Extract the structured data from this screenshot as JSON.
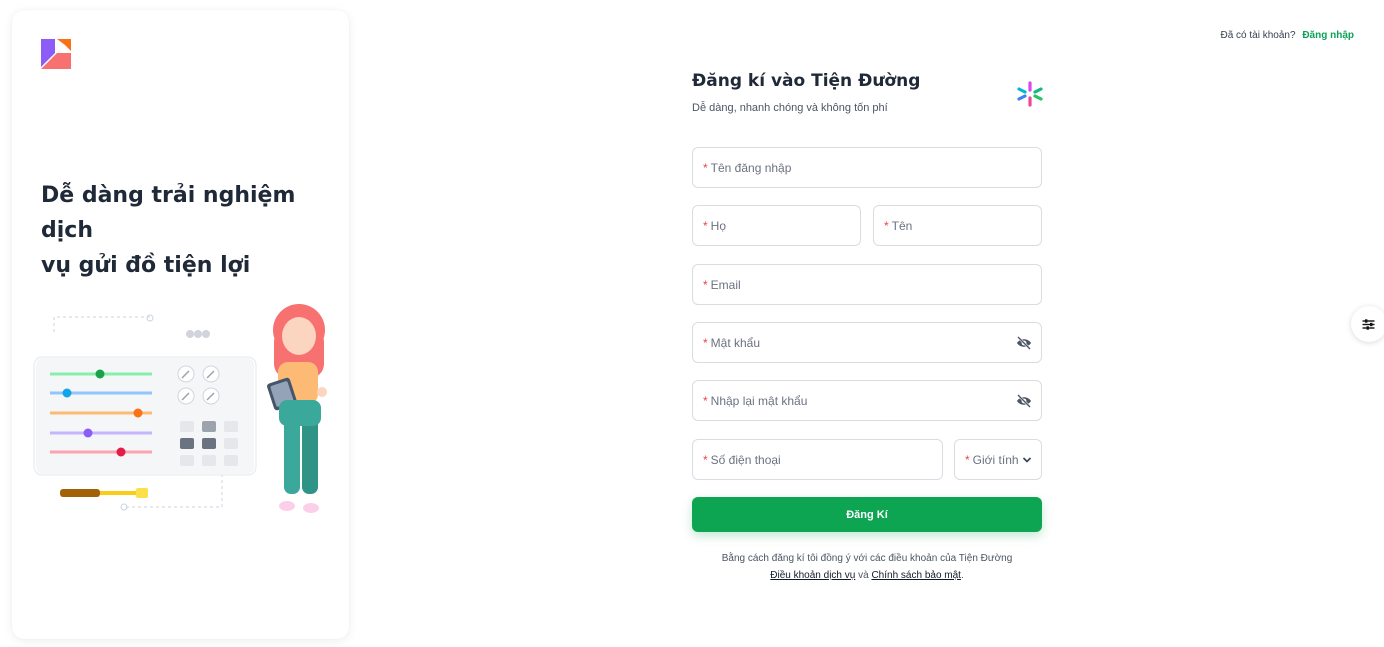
{
  "hero": {
    "line1": "Dễ dàng trải nghiệm dịch",
    "line2": "vụ gửi đồ tiện lợi"
  },
  "header": {
    "have_account": "Đã có tài khoản?",
    "login_link": "Đăng nhập"
  },
  "form": {
    "title": "Đăng kí vào Tiện Đường",
    "subtitle": "Dễ dàng, nhanh chóng và không tốn phí",
    "required_mark": "*",
    "fields": {
      "username": "Tên đăng nhập",
      "last_name": "Họ",
      "first_name": "Tên",
      "email": "Email",
      "password": "Mật khẩu",
      "confirm_password": "Nhập lại mật khẩu",
      "phone": "Số điện thoại",
      "gender": "Giới tính"
    },
    "submit_label": "Đăng Kí"
  },
  "terms": {
    "text": "Bằng cách đăng kí tôi đồng ý với các điều khoản của Tiện Đường",
    "service_link": "Điều khoản dịch vụ",
    "and": "và",
    "privacy_link": "Chính sách bảo mật",
    "period": "."
  },
  "icons": {
    "brand_logo": "brand-logo-icon",
    "form_logo": "asterisk-logo-icon",
    "eye_off": "eye-off-icon",
    "chevron": "chevron-down-icon",
    "settings": "sliders-icon"
  },
  "colors": {
    "accent": "#0ea552",
    "required": "#ef4444",
    "link": "#0ea155"
  }
}
